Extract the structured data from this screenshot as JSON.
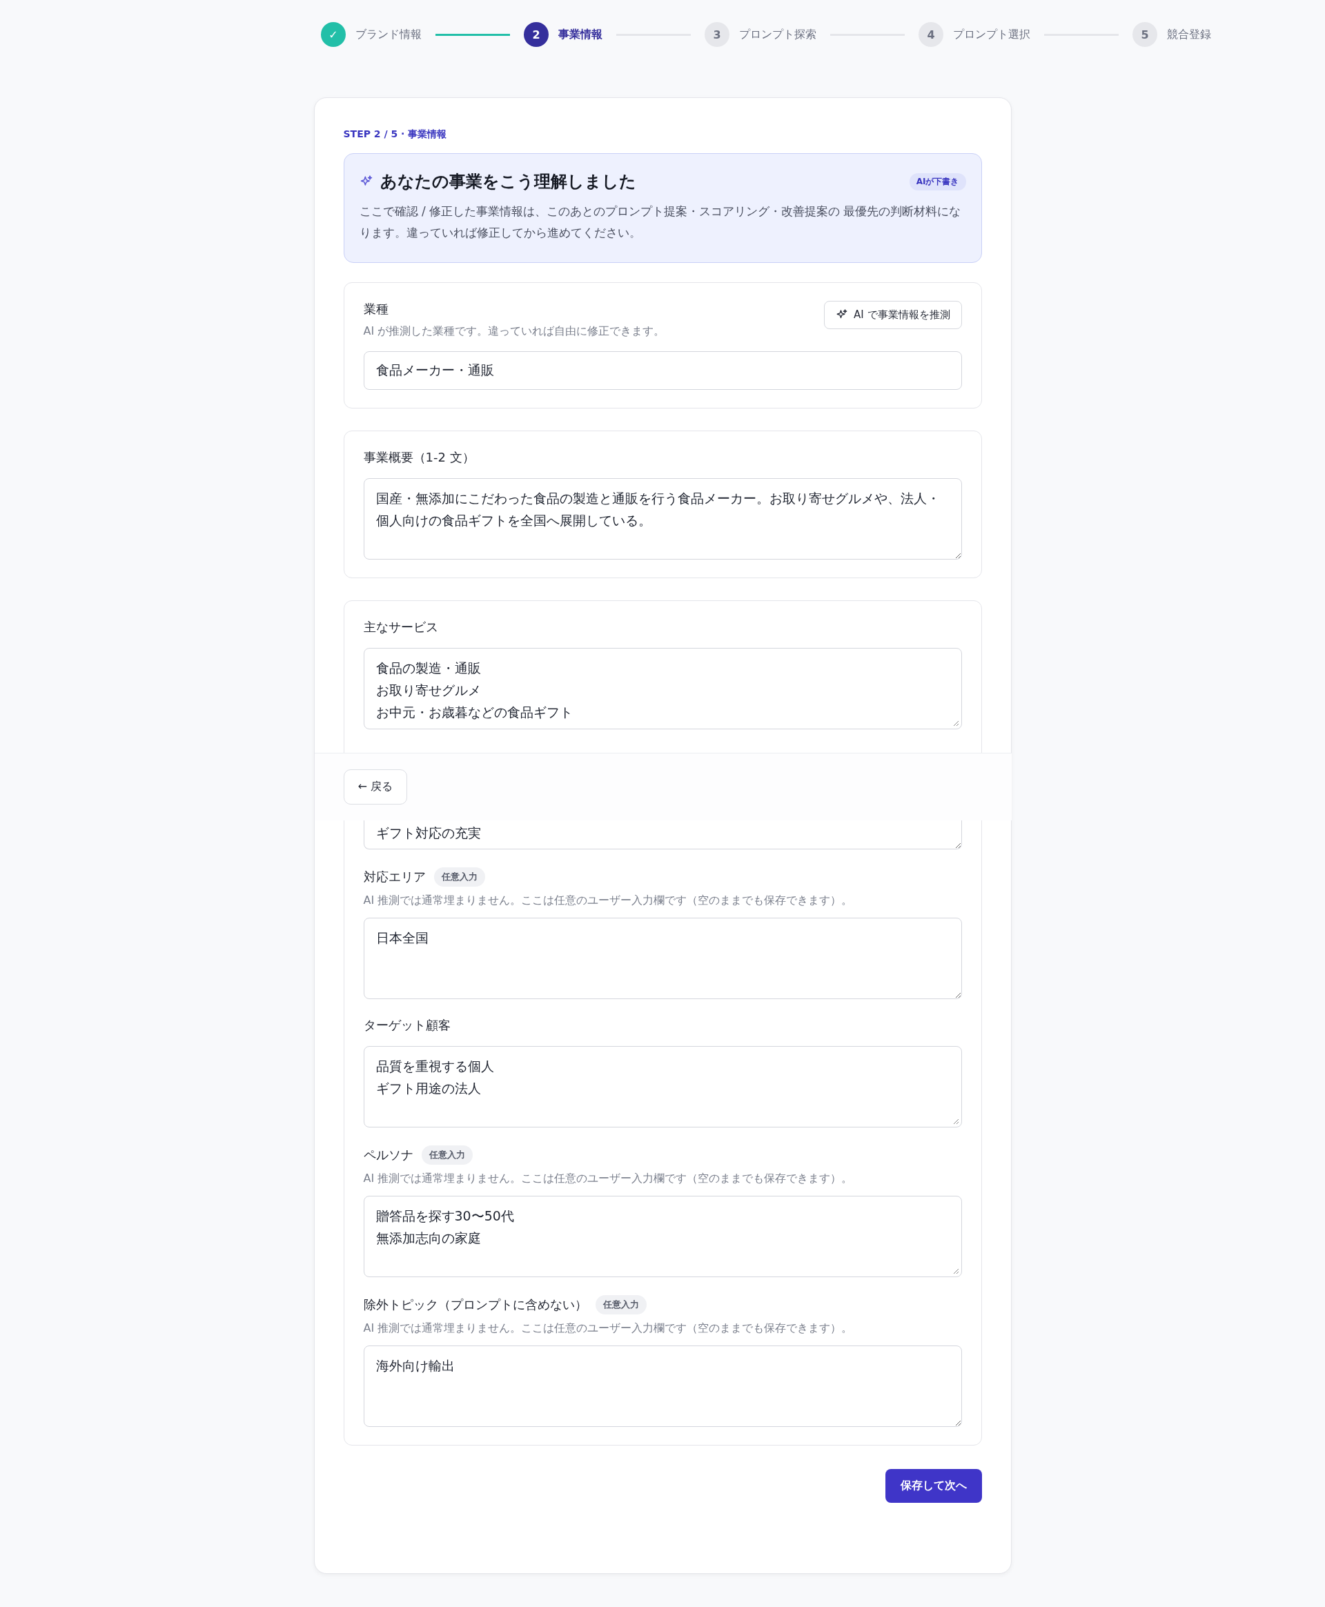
{
  "steps": [
    {
      "number": "✓",
      "label": "ブランド情報",
      "completed": true,
      "selected": false
    },
    {
      "number": "2",
      "label": "事業情報",
      "completed": false,
      "selected": true
    },
    {
      "number": "3",
      "label": "プロンプト探索",
      "completed": false,
      "selected": false
    },
    {
      "number": "4",
      "label": "プロンプト選択",
      "completed": false,
      "selected": false
    },
    {
      "number": "5",
      "label": "競合登録",
      "completed": false,
      "selected": false
    }
  ],
  "step_label": "STEP 2 / 5 · 事業情報",
  "banner": {
    "title": "あなたの事業をこう理解しました",
    "badge": "AIが下書き",
    "description": "ここで確認 / 修正した事業情報は、このあとのプロンプト提案・スコアリング・改善提案の 最優先の判断材料になります。違っていれば修正してから進めてください。"
  },
  "sections": [
    {
      "fields": [
        {
          "kind": "input",
          "label": "業種",
          "hint": "AI が推測した業種です。違っていれば自由に修正できます。",
          "value": "食品メーカー・通販",
          "action_button": "AI で事業情報を推測"
        }
      ]
    },
    {
      "fields": [
        {
          "kind": "textarea",
          "label": "事業概要（1-2 文）",
          "value": "国産・無添加にこだわった食品の製造と通販を行う食品メーカー。お取り寄せグルメや、法人・個人向けの食品ギフトを全国へ展開している。"
        }
      ]
    },
    {
      "fields": [
        {
          "kind": "textarea",
          "label": "主なサービス",
          "lines": [
            "食品の製造・通販",
            "お取り寄せグルメ",
            "お中元・お歳暮などの食品ギフト"
          ]
        },
        {
          "kind": "covered",
          "value": "ギフト対応の充実"
        },
        {
          "kind": "textarea",
          "label": "対応エリア",
          "badge": "任意入力",
          "hint": "AI 推測では通常埋まりません。ここは任意のユーザー入力欄です（空のままでも保存できます）。",
          "value": "日本全国"
        },
        {
          "kind": "textarea",
          "label": "ターゲット顧客",
          "lines": [
            "品質を重視する個人",
            "ギフト用途の法人"
          ]
        },
        {
          "kind": "textarea",
          "label": "ペルソナ",
          "badge": "任意入力",
          "hint": "AI 推測では通常埋まりません。ここは任意のユーザー入力欄です（空のままでも保存できます）。",
          "lines": [
            "贈答品を探す30〜50代",
            "無添加志向の家庭"
          ]
        },
        {
          "kind": "textarea",
          "label": "除外トピック（プロンプトに含めない）",
          "badge": "任意入力",
          "hint": "AI 推測では通常埋まりません。ここは任意のユーザー入力欄です（空のままでも保存できます）。",
          "value": "海外向け輸出"
        }
      ]
    }
  ],
  "back_button": "← 戻る",
  "next_button": "保存して次へ"
}
